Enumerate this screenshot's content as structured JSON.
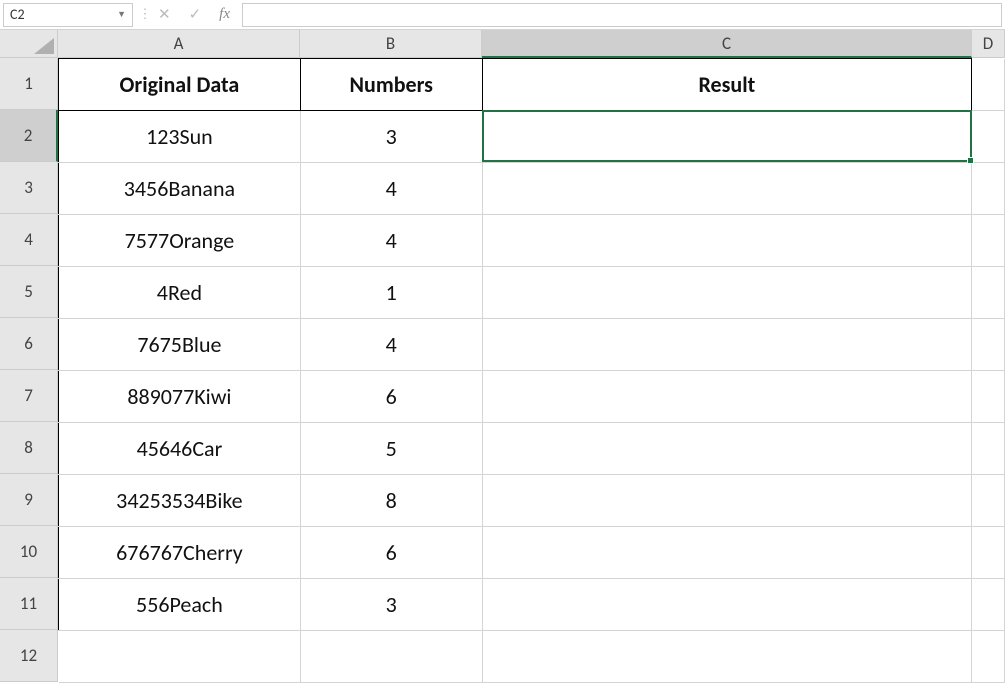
{
  "nameBox": {
    "value": "C2"
  },
  "formulaBar": {
    "value": ""
  },
  "columns": [
    {
      "label": "A",
      "selected": false
    },
    {
      "label": "B",
      "selected": false
    },
    {
      "label": "C",
      "selected": true
    },
    {
      "label": "D",
      "selected": false
    }
  ],
  "rows": [
    {
      "label": "1",
      "selected": false
    },
    {
      "label": "2",
      "selected": true
    },
    {
      "label": "3",
      "selected": false
    },
    {
      "label": "4",
      "selected": false
    },
    {
      "label": "5",
      "selected": false
    },
    {
      "label": "6",
      "selected": false
    },
    {
      "label": "7",
      "selected": false
    },
    {
      "label": "8",
      "selected": false
    },
    {
      "label": "9",
      "selected": false
    },
    {
      "label": "10",
      "selected": false
    },
    {
      "label": "11",
      "selected": false
    },
    {
      "label": "12",
      "selected": false
    }
  ],
  "headers": {
    "A": "Original Data",
    "B": "Numbers",
    "C": "Result"
  },
  "data": [
    {
      "A": "123Sun",
      "B": "3",
      "C": ""
    },
    {
      "A": "3456Banana",
      "B": "4",
      "C": ""
    },
    {
      "A": "7577Orange",
      "B": "4",
      "C": ""
    },
    {
      "A": "4Red",
      "B": "1",
      "C": ""
    },
    {
      "A": "7675Blue",
      "B": "4",
      "C": ""
    },
    {
      "A": "889077Kiwi",
      "B": "6",
      "C": ""
    },
    {
      "A": "45646Car",
      "B": "5",
      "C": ""
    },
    {
      "A": "34253534Bike",
      "B": "8",
      "C": ""
    },
    {
      "A": "676767Cherry",
      "B": "6",
      "C": ""
    },
    {
      "A": "556Peach",
      "B": "3",
      "C": ""
    }
  ],
  "activeCell": {
    "col": "C",
    "row": 2
  },
  "icons": {
    "cancel": "✕",
    "enter": "✓",
    "fx": "fx",
    "dots": "⋮",
    "dropdown": "▼"
  }
}
